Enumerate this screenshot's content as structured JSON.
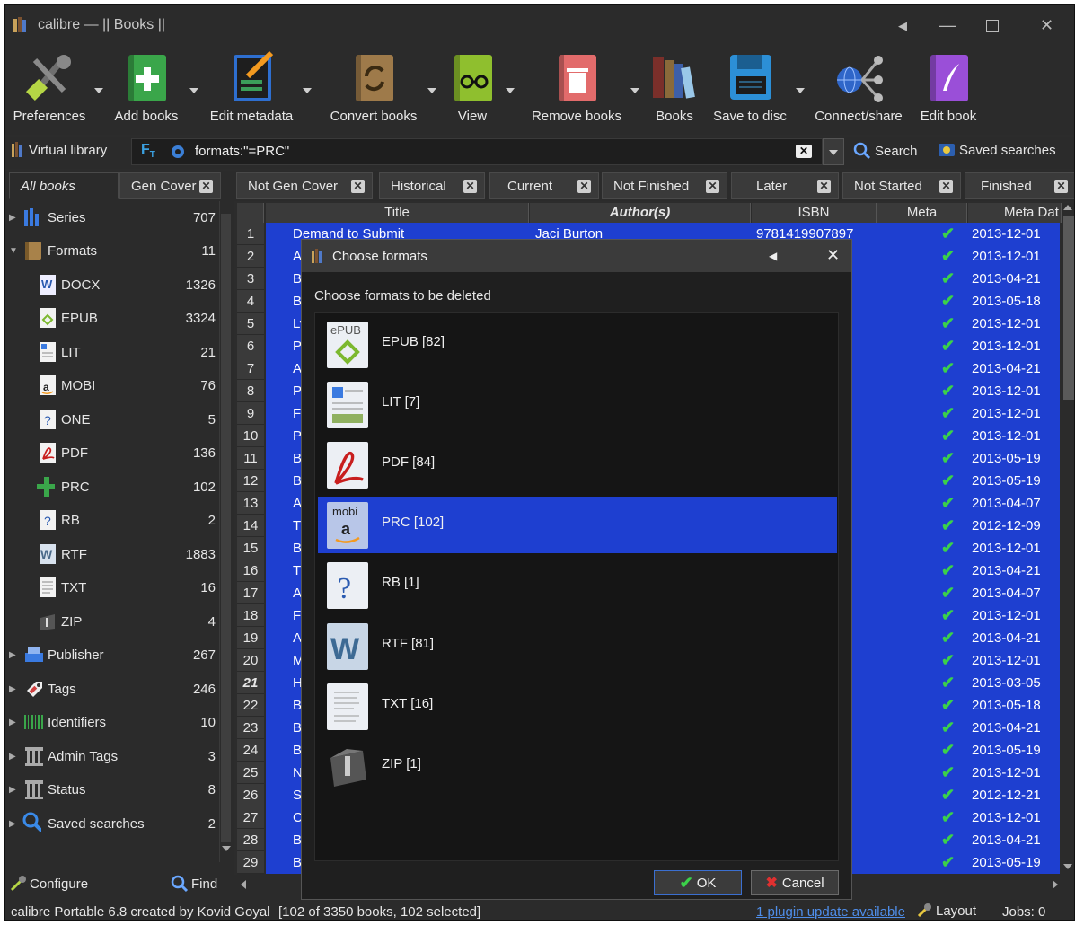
{
  "window": {
    "title": "calibre — || Books ||"
  },
  "toolbar": {
    "preferences": "Preferences",
    "add_books": "Add books",
    "edit_metadata": "Edit metadata",
    "convert_books": "Convert books",
    "view": "View",
    "remove_books": "Remove books",
    "books": "Books",
    "save_to_disc": "Save to disc",
    "connect_share": "Connect/share",
    "edit_book": "Edit book"
  },
  "search": {
    "virtual_library": "Virtual library",
    "query": "formats:\"=PRC\"",
    "search_label": "Search",
    "saved_searches": "Saved searches"
  },
  "tabs": [
    "All books",
    "Gen Cover",
    "Not Gen Cover",
    "Historical",
    "Current",
    "Not Finished",
    "Later",
    "Not Started",
    "Finished"
  ],
  "sidebar": {
    "items": [
      {
        "label": "Series",
        "count": "707",
        "icon": "series-icon"
      },
      {
        "label": "Formats",
        "count": "11",
        "icon": "formats-icon"
      },
      {
        "label": "DOCX",
        "count": "1326",
        "icon": "docx-icon"
      },
      {
        "label": "EPUB",
        "count": "3324",
        "icon": "epub-icon"
      },
      {
        "label": "LIT",
        "count": "21",
        "icon": "lit-icon"
      },
      {
        "label": "MOBI",
        "count": "76",
        "icon": "mobi-icon"
      },
      {
        "label": "ONE",
        "count": "5",
        "icon": "one-icon"
      },
      {
        "label": "PDF",
        "count": "136",
        "icon": "pdf-icon"
      },
      {
        "label": "PRC",
        "count": "102",
        "icon": "prc-icon"
      },
      {
        "label": "RB",
        "count": "2",
        "icon": "rb-icon"
      },
      {
        "label": "RTF",
        "count": "1883",
        "icon": "rtf-icon"
      },
      {
        "label": "TXT",
        "count": "16",
        "icon": "txt-icon"
      },
      {
        "label": "ZIP",
        "count": "4",
        "icon": "zip-icon"
      },
      {
        "label": "Publisher",
        "count": "267",
        "icon": "publisher-icon"
      },
      {
        "label": "Tags",
        "count": "246",
        "icon": "tags-icon"
      },
      {
        "label": "Identifiers",
        "count": "10",
        "icon": "identifiers-icon"
      },
      {
        "label": "Admin Tags",
        "count": "3",
        "icon": "admin-tags-icon"
      },
      {
        "label": "Status",
        "count": "8",
        "icon": "status-icon"
      },
      {
        "label": "Saved searches",
        "count": "2",
        "icon": "saved-searches-icon"
      }
    ],
    "configure": "Configure",
    "find": "Find"
  },
  "table": {
    "columns": [
      "Title",
      "Author(s)",
      "ISBN",
      "Meta",
      "Meta Dat"
    ],
    "first_row": {
      "title": "Demand to Submit",
      "author": "Jaci Burton",
      "isbn": "9781419907897"
    },
    "row_title_initials": [
      "",
      "A",
      "B",
      "B",
      "Ly",
      "P",
      "A",
      "P",
      "F",
      "P",
      "B",
      "B",
      "A",
      "T",
      "B",
      "T",
      "A",
      "F",
      "A",
      "M",
      "H",
      "B",
      "B",
      "B",
      "N",
      "S",
      "C",
      "B",
      "B"
    ],
    "dates": [
      "2013-12-01",
      "2013-12-01",
      "2013-04-21",
      "2013-05-18",
      "2013-12-01",
      "2013-12-01",
      "2013-04-21",
      "2013-12-01",
      "2013-12-01",
      "2013-12-01",
      "2013-05-19",
      "2013-05-19",
      "2013-04-07",
      "2012-12-09",
      "2013-12-01",
      "2013-04-21",
      "2013-04-07",
      "2013-12-01",
      "2013-04-21",
      "2013-12-01",
      "2013-03-05",
      "2013-05-18",
      "2013-04-21",
      "2013-05-19",
      "2013-12-01",
      "2012-12-21",
      "2013-12-01",
      "2013-04-21",
      "2013-05-19"
    ]
  },
  "dialog": {
    "title": "Choose formats",
    "prompt": "Choose formats to be deleted",
    "formats": [
      {
        "label": "EPUB [82]",
        "icon": "epub-icon"
      },
      {
        "label": "LIT [7]",
        "icon": "lit-icon"
      },
      {
        "label": "PDF [84]",
        "icon": "pdf-icon"
      },
      {
        "label": "PRC [102]",
        "icon": "mobi-icon",
        "selected": true
      },
      {
        "label": "RB [1]",
        "icon": "rb-icon"
      },
      {
        "label": "RTF [81]",
        "icon": "rtf-icon"
      },
      {
        "label": "TXT [16]",
        "icon": "txt-icon"
      },
      {
        "label": "ZIP [1]",
        "icon": "zip-icon"
      }
    ],
    "ok": "OK",
    "cancel": "Cancel"
  },
  "status": {
    "left": "calibre Portable 6.8 created by Kovid Goyal",
    "count": "[102 of 3350 books, 102 selected]",
    "update": "1 plugin update available",
    "layout": "Layout",
    "jobs": "Jobs: 0"
  },
  "colors": {
    "selection": "#1e3fd0",
    "background": "#2b2b2b",
    "check": "#3bd14a"
  }
}
